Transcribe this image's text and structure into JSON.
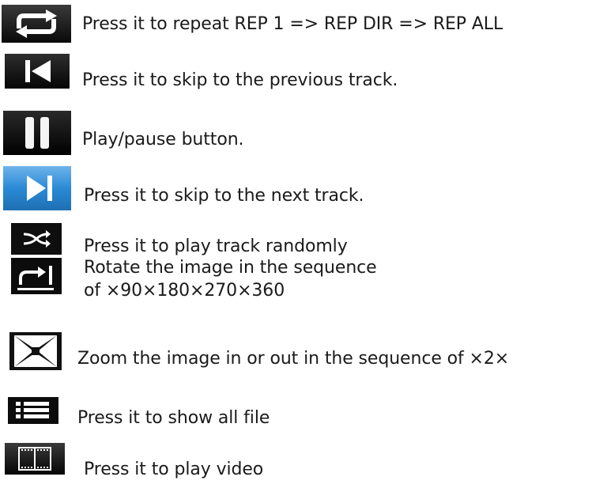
{
  "items": [
    {
      "icon": "repeat-icon",
      "text": "Press it to repeat REP 1 => REP DIR => REP ALL"
    },
    {
      "icon": "skip-previous-icon",
      "text": "Press it to skip to the previous track."
    },
    {
      "icon": "pause-icon",
      "text": "Play/pause button."
    },
    {
      "icon": "skip-next-icon",
      "text": "Press it to skip to the next track."
    },
    {
      "icon": "shuffle-icon",
      "text": "Press it to play track randomly"
    },
    {
      "icon": "rotate-icon",
      "text_line1": "Rotate the image in the sequence",
      "text_line2": "of ×90×180×270×360"
    },
    {
      "icon": "zoom-icon",
      "text": "Zoom the image in or out in the sequence of ×2×"
    },
    {
      "icon": "list-icon",
      "text": "Press it to show all file"
    },
    {
      "icon": "video-film-icon",
      "text": "Press it to play video"
    }
  ]
}
